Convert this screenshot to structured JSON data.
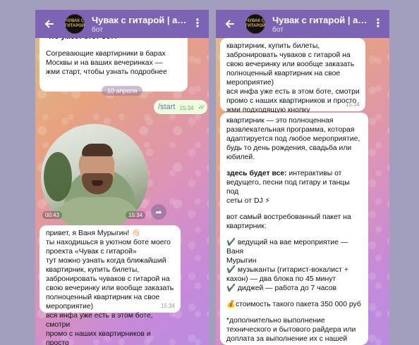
{
  "left": {
    "header": {
      "title": "Чувак с гитарой | афиша, г",
      "subtitle": "бот",
      "avatar_text": "ЧУВАК С ГИТАРОЙ"
    },
    "intro_bubble": {
      "top_line": "Что умеет этот бот?",
      "text": "Согревающие квартирники в барах\nМосквы и на ваших вечеринках —\nжми старт, чтобы узнать подробнее"
    },
    "date": "10 апреля",
    "start_message": {
      "text": "/start",
      "time": "15:34"
    },
    "video": {
      "duration": "00:43",
      "time": "15:34"
    },
    "message": {
      "text": "привет, я Ваня Мурыгин! 👋🏻\nты находишься в уютном боте моего\nпроекта «Чувак с гитарой»\nтут можно узнать когда ближайший\nквартирник, купить билеты,\nзабронировать чуваков с гитарой на\nсвою вечеринку или вообще заказать\nполноценный квартирник на свое\nмероприятие)\nвся инфа уже есть в этом боте, смотри\nпромо с наших квартирников и просто\nжми подходящую кнопку",
      "time": "15:34"
    }
  },
  "right": {
    "header": {
      "title": "Чувак с гитарой | афиша, г",
      "subtitle": "бот",
      "avatar_text": "ЧУВАК С ГИТАРОЙ"
    },
    "top_message": {
      "text": "квартирник, купить билеты,\nзабронировать чуваков с гитарой на\nсвою вечеринку или вообще заказать\nполноценный квартирник на свое\nмероприятие)\nвся инфа уже есть в этом боте, смотри\nпромо с наших квартирников и просто\nжми подходящую кнопку",
      "time": "15:34"
    },
    "info_message": {
      "p1": "квартирник — это полноценная\nразвлекательная программа, которая\nадаптируется под любое мероприятие,\nбудь то день рождения, свадьба или\nюбилей.",
      "p2_bold": "здесь будет все:",
      "p2_rest": " интерактивы от\nведущего, песни под гитару и танцы под\nсеты от DJ ⚡",
      "p3": "вот самый востребованный пакет на\nквартирник:",
      "items": [
        "✔️ ведущий на вае мероприятие — Ваня\nМурыгин",
        "✔️ музыканты (гитарист-вокалист +\nкахон) — два блока по 45 минут",
        "✔️ диджей — работа до 7 часов"
      ],
      "price": "💰стоимость такого пакета 350 000 руб",
      "note": "*дополнительно выполнение\nтехнического и бытового райдера или\nдоплата за выполнение их с нашей\nстороны"
    }
  }
}
